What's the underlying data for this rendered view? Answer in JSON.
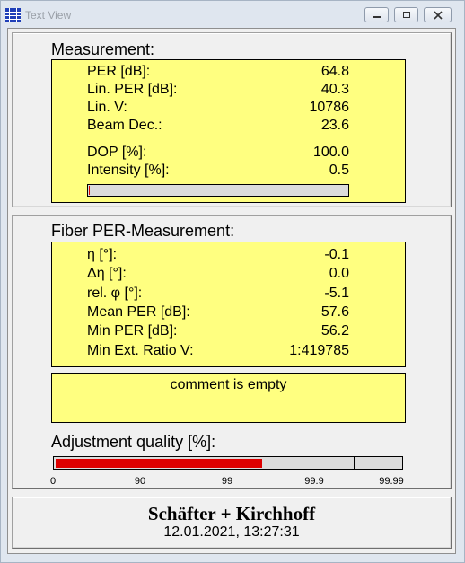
{
  "window": {
    "title": "Text View"
  },
  "measurement": {
    "heading": "Measurement:",
    "rows": [
      {
        "label": "PER [dB]:",
        "value": "64.8"
      },
      {
        "label": "Lin. PER [dB]:",
        "value": "40.3"
      },
      {
        "label": "Lin. V:",
        "value": "10786"
      },
      {
        "label": "Beam Dec.:",
        "value": "23.6"
      },
      {
        "label": "DOP [%]:",
        "value": "100.0"
      },
      {
        "label": "Intensity [%]:",
        "value": "0.5"
      }
    ],
    "intensity_level_percent": 0.5
  },
  "fiber": {
    "heading": "Fiber PER-Measurement:",
    "rows": [
      {
        "label": "η [°]:",
        "value": "-0.1"
      },
      {
        "label": "Δη [°]:",
        "value": "0.0"
      },
      {
        "label": "rel. φ [°]:",
        "value": "-5.1"
      },
      {
        "label": "Mean PER [dB]:",
        "value": "57.6"
      },
      {
        "label": "Min  PER [dB]:",
        "value": "56.2"
      },
      {
        "label": "Min Ext. Ratio V:",
        "value": "1:419785"
      }
    ],
    "comment": "comment is empty",
    "adjustment": {
      "heading": "Adjustment quality [%]:",
      "ticks": [
        "0",
        "90",
        "99",
        "99.9",
        "99.99"
      ],
      "fill_fraction": 0.6,
      "marker_fraction": 0.87,
      "fill_color": "#dd0000"
    }
  },
  "footer": {
    "company": "Schäfter + Kirchhoff",
    "datetime": "12.01.2021, 13:27:31"
  },
  "colors": {
    "panel": "#ffff80",
    "client": "#f0f0f0"
  }
}
